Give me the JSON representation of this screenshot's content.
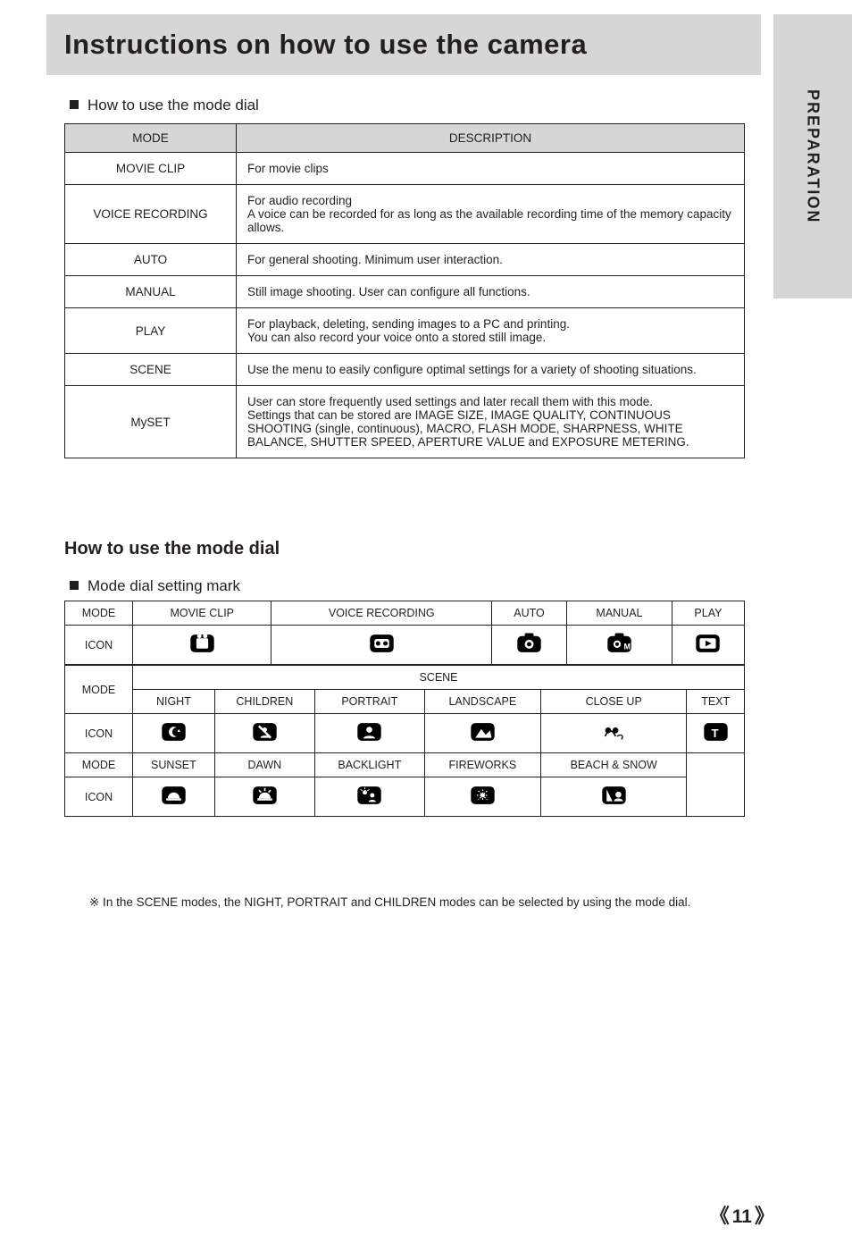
{
  "banner": "Instructions on how to use the camera",
  "side_tab": "PREPARATION",
  "hd1": "How to use the mode dial",
  "table1": [
    {
      "mode": "MOVIE CLIP",
      "desc": "For movie clips"
    },
    {
      "mode": "VOICE RECORDING",
      "desc": "For audio recording\nA voice can be recorded for as long as the available recording time of the memory capacity allows."
    },
    {
      "mode": "AUTO",
      "desc": "For general shooting. Minimum user interaction."
    },
    {
      "mode": "MANUAL",
      "desc": "Still image shooting. User can configure all functions."
    },
    {
      "mode": "PLAY",
      "desc": "For playback, deleting, sending images to a PC and printing.\nYou can also record your voice onto a stored still image."
    },
    {
      "mode": "SCENE",
      "desc": "Use the menu to easily configure optimal settings for a variety of shooting situations."
    },
    {
      "mode": "MySET",
      "desc": "User can store frequently used settings and later recall them with this mode.\nSettings that can be stored are IMAGE SIZE, IMAGE QUALITY, CONTINUOUS SHOOTING (single, continuous), MACRO, FLASH MODE, SHARPNESS, WHITE BALANCE, SHUTTER SPEED, APERTURE VALUE and EXPOSURE METERING."
    }
  ],
  "subhead": "How to use the mode dial",
  "hd2": "Mode dial setting mark",
  "cols": {
    "mode": "MODE",
    "icon": "ICON"
  },
  "modes_top": [
    "MOVIE CLIP",
    "VOICE RECORDING",
    "AUTO",
    "MANUAL",
    "PLAY"
  ],
  "scene_label": "SCENE",
  "scene_sub": [
    "NIGHT",
    "CHILDREN",
    "PORTRAIT",
    "LANDSCAPE",
    "CLOSE UP",
    "TEXT"
  ],
  "scene_sub2": [
    "SUNSET",
    "DAWN",
    "BACKLIGHT",
    "FIREWORKS",
    "BEACH & SNOW"
  ],
  "scene_note": "※ In the SCENE modes, the NIGHT, PORTRAIT and CHILDREN modes can be selected by using the mode dial.",
  "page": "11"
}
